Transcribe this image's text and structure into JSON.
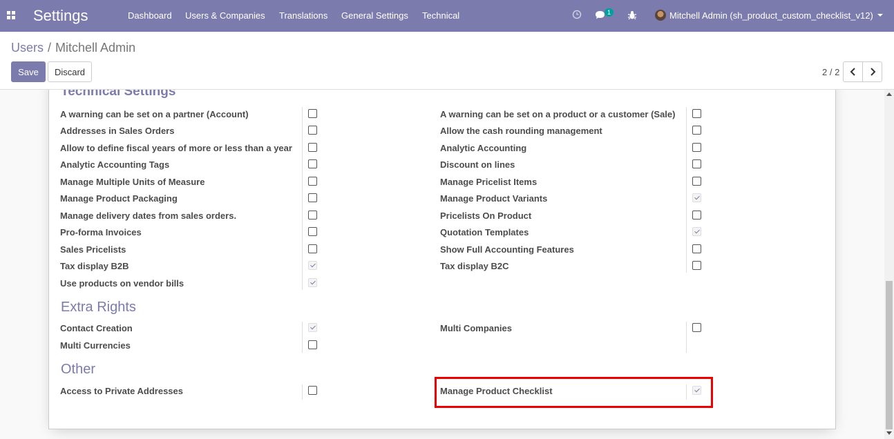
{
  "navbar": {
    "app_title": "Settings",
    "menu": [
      "Dashboard",
      "Users & Companies",
      "Translations",
      "General Settings",
      "Technical"
    ],
    "messages_count": "1",
    "user_name": "Mitchell Admin (sh_product_custom_checklist_v12)",
    "icons": {
      "apps": "grid-icon",
      "activity": "clock-icon",
      "messages": "chat-icon",
      "debug": "bug-icon"
    },
    "color": "#7c7bad"
  },
  "breadcrumb": {
    "parent": "Users",
    "current": "Mitchell Admin"
  },
  "buttons": {
    "save": "Save",
    "discard": "Discard"
  },
  "pager": {
    "value": "2 / 2"
  },
  "sections": {
    "technical": {
      "title": "Technical Settings",
      "left": [
        {
          "label": "A warning can be set on a partner (Account)",
          "checked": false
        },
        {
          "label": "Addresses in Sales Orders",
          "checked": false
        },
        {
          "label": "Allow to define fiscal years of more or less than a year",
          "checked": false
        },
        {
          "label": "Analytic Accounting Tags",
          "checked": false
        },
        {
          "label": "Manage Multiple Units of Measure",
          "checked": false
        },
        {
          "label": "Manage Product Packaging",
          "checked": false
        },
        {
          "label": "Manage delivery dates from sales orders.",
          "checked": false
        },
        {
          "label": "Pro-forma Invoices",
          "checked": false
        },
        {
          "label": "Sales Pricelists",
          "checked": false
        },
        {
          "label": "Tax display B2B",
          "checked": true
        },
        {
          "label": "Use products on vendor bills",
          "checked": true
        }
      ],
      "right": [
        {
          "label": "A warning can be set on a product or a customer (Sale)",
          "checked": false
        },
        {
          "label": "Allow the cash rounding management",
          "checked": false
        },
        {
          "label": "Analytic Accounting",
          "checked": false
        },
        {
          "label": "Discount on lines",
          "checked": false
        },
        {
          "label": "Manage Pricelist Items",
          "checked": false
        },
        {
          "label": "Manage Product Variants",
          "checked": true
        },
        {
          "label": "Pricelists On Product",
          "checked": false
        },
        {
          "label": "Quotation Templates",
          "checked": true
        },
        {
          "label": "Show Full Accounting Features",
          "checked": false
        },
        {
          "label": "Tax display B2C",
          "checked": false
        }
      ]
    },
    "extra": {
      "title": "Extra Rights",
      "left": [
        {
          "label": "Contact Creation",
          "checked": true
        },
        {
          "label": "Multi Currencies",
          "checked": false
        }
      ],
      "right": [
        {
          "label": "Multi Companies",
          "checked": false
        }
      ]
    },
    "other": {
      "title": "Other",
      "left": [
        {
          "label": "Access to Private Addresses",
          "checked": false
        }
      ],
      "right": [
        {
          "label": "Manage Product Checklist",
          "checked": true
        }
      ]
    }
  },
  "highlight_color": "#ee0000"
}
